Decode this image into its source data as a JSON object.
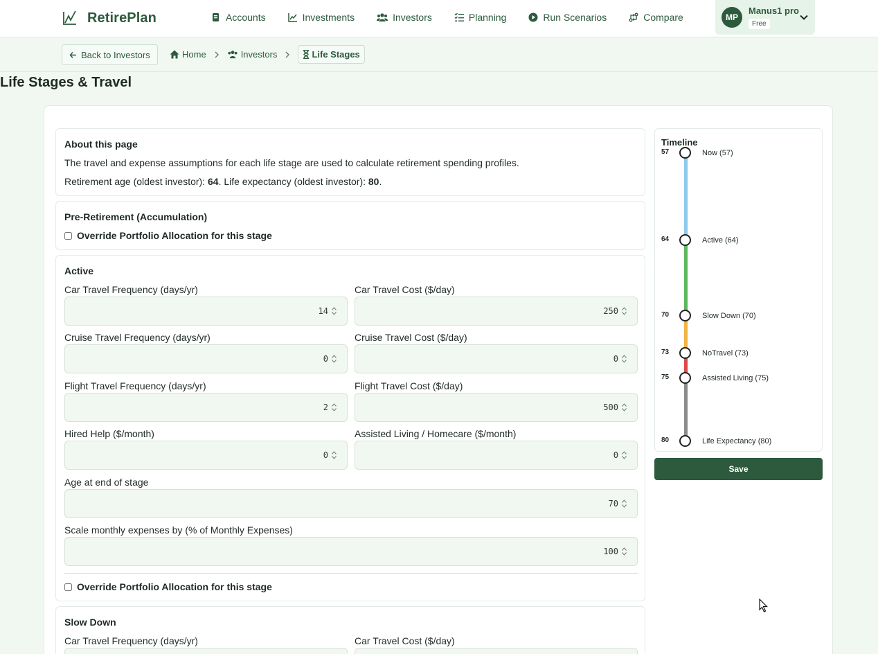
{
  "app": {
    "name": "RetirePlan"
  },
  "nav": {
    "items": [
      {
        "label": "Accounts",
        "icon": "wallet-icon"
      },
      {
        "label": "Investments",
        "icon": "chart-line-icon"
      },
      {
        "label": "Investors",
        "icon": "users-icon"
      },
      {
        "label": "Planning",
        "icon": "list-check-icon"
      },
      {
        "label": "Run Scenarios",
        "icon": "play-circle-icon"
      },
      {
        "label": "Compare",
        "icon": "compare-arrows-icon"
      }
    ]
  },
  "user": {
    "initials": "MP",
    "name": "Manus1 pro",
    "plan": "Free"
  },
  "breadcrumb": {
    "back_label": "Back to Investors",
    "home": "Home",
    "investors": "Investors",
    "current": "Life Stages"
  },
  "page": {
    "title": "Life Stages & Travel"
  },
  "about": {
    "heading": "About this page",
    "description": "The travel and expense assumptions for each life stage are used to calculate retirement spending profiles.",
    "retirement_age_label": "Retirement age (oldest investor): ",
    "retirement_age": "64",
    "life_expectancy_label": ". Life expectancy (oldest investor): ",
    "life_expectancy": "80",
    "end": "."
  },
  "pre_retirement": {
    "heading": "Pre-Retirement (Accumulation)",
    "override_label": "Override Portfolio Allocation for this stage"
  },
  "active": {
    "heading": "Active",
    "car_freq_label": "Car Travel Frequency (days/yr)",
    "car_freq": "14",
    "car_cost_label": "Car Travel Cost ($/day)",
    "car_cost": "250",
    "cruise_freq_label": "Cruise Travel Frequency (days/yr)",
    "cruise_freq": "0",
    "cruise_cost_label": "Cruise Travel Cost ($/day)",
    "cruise_cost": "0",
    "flight_freq_label": "Flight Travel Frequency (days/yr)",
    "flight_freq": "2",
    "flight_cost_label": "Flight Travel Cost ($/day)",
    "flight_cost": "500",
    "hired_help_label": "Hired Help ($/month)",
    "hired_help": "0",
    "assisted_label": "Assisted Living / Homecare ($/month)",
    "assisted": "0",
    "end_age_label": "Age at end of stage",
    "end_age": "70",
    "scale_label": "Scale monthly expenses by (% of Monthly Expenses)",
    "scale": "100",
    "override_label": "Override Portfolio Allocation for this stage"
  },
  "slow_down": {
    "heading": "Slow Down",
    "car_freq_label": "Car Travel Frequency (days/yr)",
    "car_cost_label": "Car Travel Cost ($/day)"
  },
  "timeline": {
    "title": "Timeline",
    "stages": [
      {
        "age": "57",
        "label": "Now (57)",
        "color": "#8ec9ee"
      },
      {
        "age": "64",
        "label": "Active (64)",
        "color": "#5cb85c"
      },
      {
        "age": "70",
        "label": "Slow Down (70)",
        "color": "#f0b443"
      },
      {
        "age": "73",
        "label": "NoTravel (73)",
        "color": "#e04848"
      },
      {
        "age": "75",
        "label": "Assisted Living (75)",
        "color": "#8c8c8c"
      },
      {
        "age": "80",
        "label": "Life Expectancy (80)"
      }
    ]
  },
  "actions": {
    "save_label": "Save"
  },
  "colors": {
    "primary": "#2d5a3d",
    "background": "#f0f8f1",
    "input_bg": "#f0f8f1"
  }
}
